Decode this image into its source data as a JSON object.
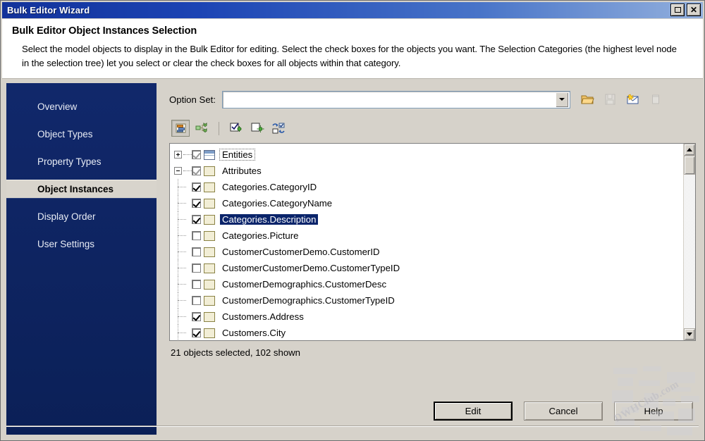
{
  "window": {
    "title": "Bulk Editor Wizard",
    "restore_label": "Restore",
    "close_label": "Close"
  },
  "header": {
    "title": "Bulk Editor Object Instances Selection",
    "description": "Select the model objects to display in the Bulk Editor for editing. Select the check boxes for the objects you want. The Selection Categories (the highest level node in the selection tree) let you select or clear the check boxes for all objects within that category."
  },
  "sidebar": {
    "items": [
      {
        "label": "Overview",
        "active": false
      },
      {
        "label": "Object Types",
        "active": false
      },
      {
        "label": "Property Types",
        "active": false
      },
      {
        "label": "Object Instances",
        "active": true
      },
      {
        "label": "Display Order",
        "active": false
      },
      {
        "label": "User Settings",
        "active": false
      }
    ]
  },
  "option_set": {
    "label": "Option Set:",
    "value": "",
    "placeholder": "",
    "icons": [
      {
        "name": "open-folder-icon",
        "title": "Open Option Set",
        "enabled": true
      },
      {
        "name": "save-icon",
        "title": "Save Option Set",
        "enabled": false
      },
      {
        "name": "new-option-set-icon",
        "title": "New Option Set",
        "enabled": true
      },
      {
        "name": "delete-icon",
        "title": "Delete Option Set",
        "enabled": false
      }
    ]
  },
  "toolbar": {
    "buttons": [
      {
        "name": "flat-list-view-button",
        "title": "Flat List View",
        "pressed": true
      },
      {
        "name": "hierarchy-view-button",
        "title": "Hierarchy View",
        "pressed": false
      },
      {
        "name": "check-all-button",
        "title": "Check All",
        "pressed": false
      },
      {
        "name": "uncheck-all-button",
        "title": "Uncheck All",
        "pressed": false
      },
      {
        "name": "invert-selection-button",
        "title": "Invert Selection",
        "pressed": false
      }
    ]
  },
  "tree": {
    "nodes": [
      {
        "label": "Entities",
        "level": 0,
        "expander": "plus",
        "checkbox": "gray",
        "icon": "entity",
        "selected": false,
        "focused": true
      },
      {
        "label": "Attributes",
        "level": 0,
        "expander": "minus",
        "checkbox": "gray",
        "icon": "attr",
        "selected": false,
        "focused": false
      },
      {
        "label": "Categories.CategoryID",
        "level": 1,
        "expander": "none",
        "checkbox": "checked",
        "icon": "attr",
        "selected": false,
        "focused": false
      },
      {
        "label": "Categories.CategoryName",
        "level": 1,
        "expander": "none",
        "checkbox": "checked",
        "icon": "attr",
        "selected": false,
        "focused": false
      },
      {
        "label": "Categories.Description",
        "level": 1,
        "expander": "none",
        "checkbox": "checked",
        "icon": "attr",
        "selected": true,
        "focused": false
      },
      {
        "label": "Categories.Picture",
        "level": 1,
        "expander": "none",
        "checkbox": "unchecked",
        "icon": "attr",
        "selected": false,
        "focused": false
      },
      {
        "label": "CustomerCustomerDemo.CustomerID",
        "level": 1,
        "expander": "none",
        "checkbox": "unchecked",
        "icon": "attr",
        "selected": false,
        "focused": false
      },
      {
        "label": "CustomerCustomerDemo.CustomerTypeID",
        "level": 1,
        "expander": "none",
        "checkbox": "unchecked",
        "icon": "attr",
        "selected": false,
        "focused": false
      },
      {
        "label": "CustomerDemographics.CustomerDesc",
        "level": 1,
        "expander": "none",
        "checkbox": "unchecked",
        "icon": "attr",
        "selected": false,
        "focused": false
      },
      {
        "label": "CustomerDemographics.CustomerTypeID",
        "level": 1,
        "expander": "none",
        "checkbox": "unchecked",
        "icon": "attr",
        "selected": false,
        "focused": false
      },
      {
        "label": "Customers.Address",
        "level": 1,
        "expander": "none",
        "checkbox": "checked",
        "icon": "attr",
        "selected": false,
        "focused": false
      },
      {
        "label": "Customers.City",
        "level": 1,
        "expander": "none",
        "checkbox": "checked",
        "icon": "attr",
        "selected": false,
        "focused": false
      }
    ]
  },
  "status": {
    "text": "21 objects selected, 102 shown"
  },
  "footer": {
    "buttons": [
      {
        "label": "Edit",
        "name": "edit-button",
        "default": true,
        "obscured": false
      },
      {
        "label": "Cancel",
        "name": "cancel-button",
        "default": false,
        "obscured": false
      },
      {
        "label": "Help",
        "name": "help-button",
        "default": false,
        "obscured": true
      }
    ]
  },
  "watermark": {
    "text": "DWHClub.com"
  },
  "colors": {
    "titlebar_start": "#12329a",
    "titlebar_end": "#93b0dd",
    "sidebar_bg": "#0c2461",
    "selection_blue": "#0a246a",
    "window_bg": "#d6d2ca"
  }
}
